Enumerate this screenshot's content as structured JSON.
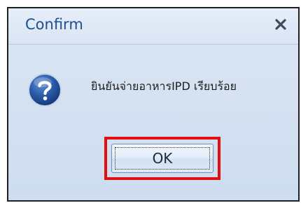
{
  "dialog": {
    "title": "Confirm",
    "close_icon": "close-icon",
    "message_icon": "question-icon",
    "message": "ยินยันจ่ายอาหารIPD เรียบร้อย",
    "ok_label": "OK"
  },
  "colors": {
    "title_text": "#1e4f8f",
    "highlight_border": "#e01010",
    "icon_blue": "#1f4f9a"
  }
}
